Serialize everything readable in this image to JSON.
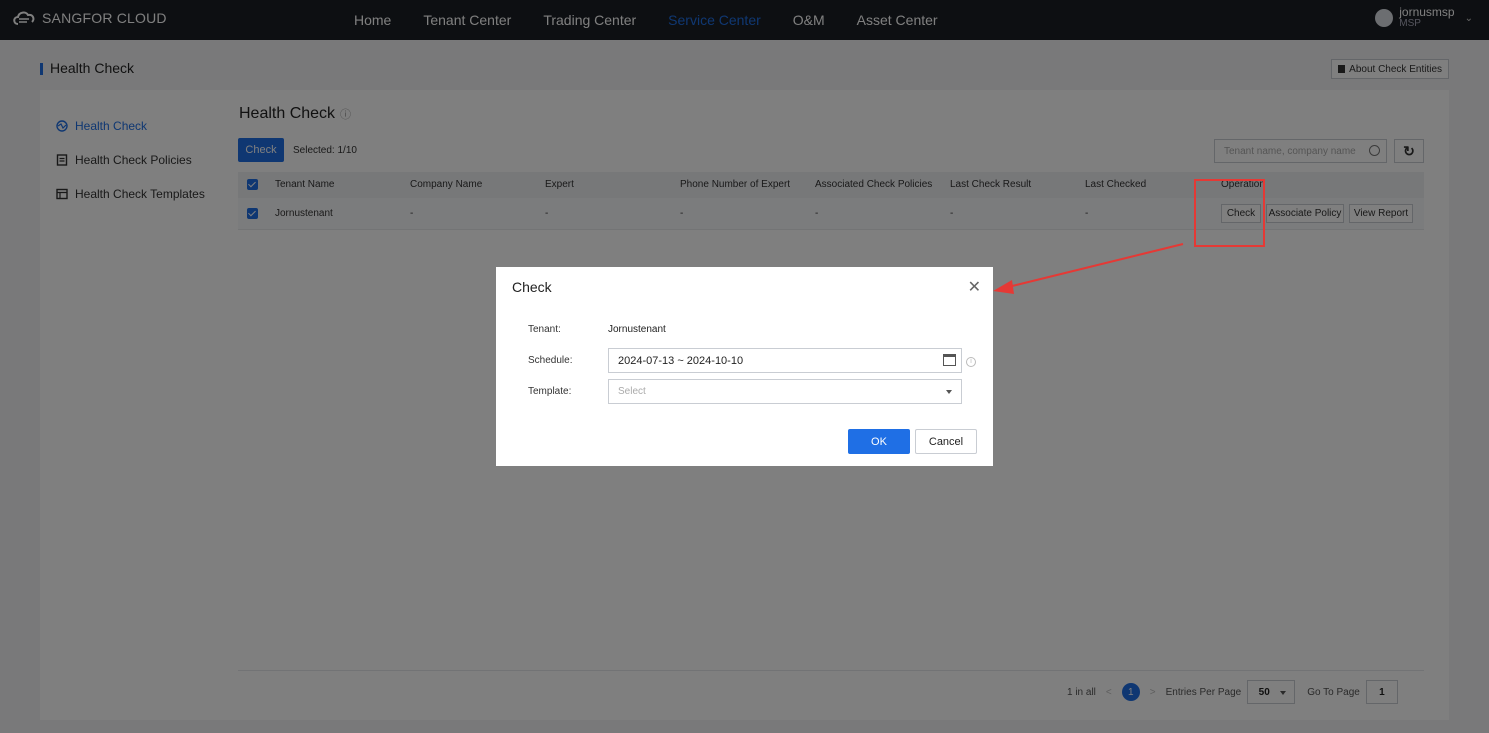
{
  "brand": {
    "name": "SANGFOR CLOUD"
  },
  "nav": {
    "items": [
      "Home",
      "Tenant Center",
      "Trading Center",
      "Service Center",
      "O&M",
      "Asset Center"
    ],
    "active": "Service Center"
  },
  "user": {
    "name": "jornusmsp",
    "role": "MSP"
  },
  "page": {
    "title": "Health Check",
    "about_button": "About Check Entities"
  },
  "sidebar": {
    "items": [
      {
        "label": "Health Check",
        "icon": "health-check-icon",
        "active": true
      },
      {
        "label": "Health Check Policies",
        "icon": "policy-icon",
        "active": false
      },
      {
        "label": "Health Check Templates",
        "icon": "template-icon",
        "active": false
      }
    ]
  },
  "main": {
    "heading": "Health Check",
    "check_button": "Check",
    "selected_text": "Selected: 1/10",
    "search_placeholder": "Tenant name, company name",
    "table": {
      "columns": [
        "Tenant Name",
        "Company Name",
        "Expert",
        "Phone Number of Expert",
        "Associated Check Policies",
        "Last Check Result",
        "Last Checked",
        "Operation"
      ],
      "rows": [
        {
          "cells": [
            "Jornustenant",
            "-",
            "-",
            "-",
            "-",
            "-",
            "-"
          ],
          "actions": [
            "Check",
            "Associate Policy",
            "View Report"
          ]
        }
      ]
    },
    "pagination": {
      "total_text": "1 in all",
      "current_page": "1",
      "entries_label": "Entries Per Page",
      "entries_value": "50",
      "goto_label": "Go To Page",
      "goto_value": "1"
    }
  },
  "dialog": {
    "title": "Check",
    "tenant_label": "Tenant:",
    "tenant_value": "Jornustenant",
    "schedule_label": "Schedule:",
    "schedule_value": "2024-07-13 ~ 2024-10-10",
    "template_label": "Template:",
    "template_placeholder": "Select",
    "ok_label": "OK",
    "cancel_label": "Cancel"
  },
  "colors": {
    "accent": "#1f6fe5",
    "topbar": "#1b1f24",
    "annotation": "#e53935"
  }
}
